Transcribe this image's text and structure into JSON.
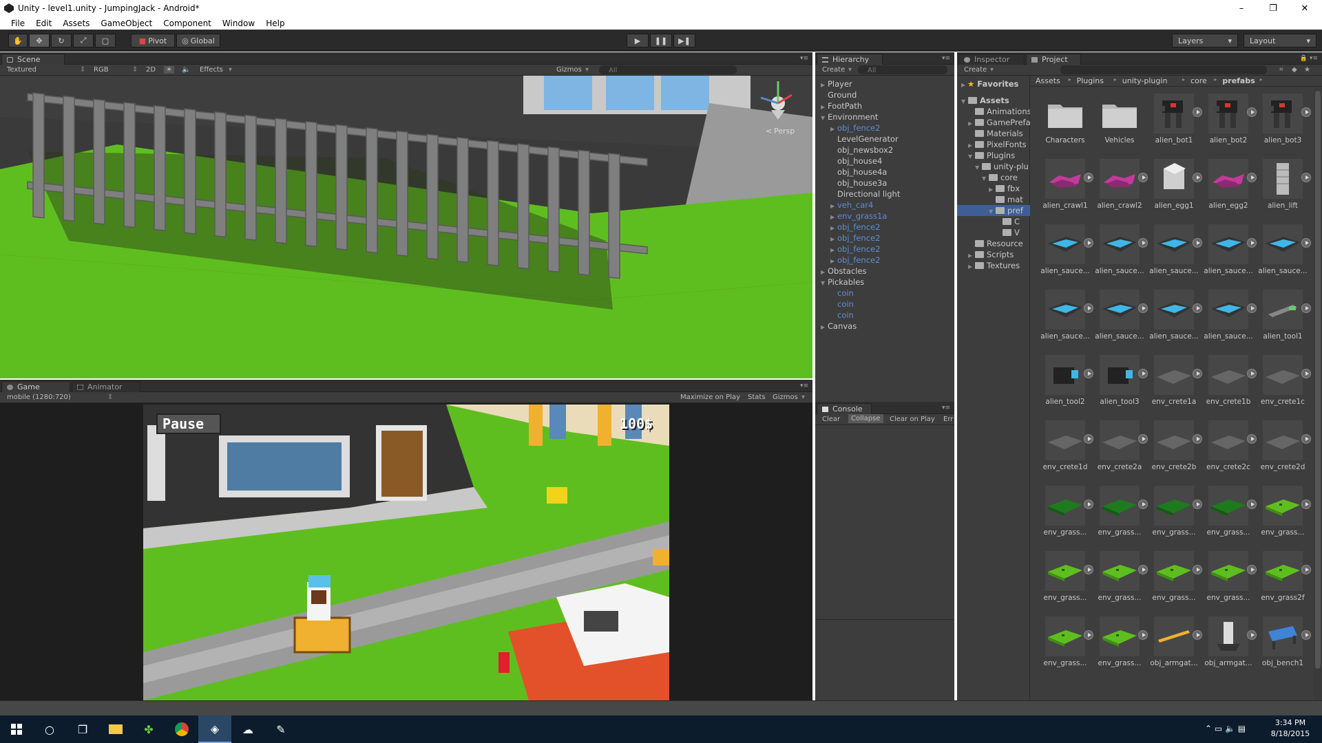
{
  "window": {
    "title": "Unity - level1.unity - JumpingJack - Android*",
    "minimize": "–",
    "maximize": "❐",
    "close": "✕"
  },
  "menu": [
    "File",
    "Edit",
    "Assets",
    "GameObject",
    "Component",
    "Window",
    "Help"
  ],
  "toolbar": {
    "pivot": "Pivot",
    "global": "Global",
    "layers": "Layers",
    "layout": "Layout"
  },
  "scene": {
    "tab": "Scene",
    "shading": "Textured",
    "render": "RGB",
    "mode2d": "2D",
    "effects": "Effects",
    "gizmos": "Gizmos",
    "search_placeholder": "All",
    "persp": "Persp"
  },
  "game": {
    "tab_game": "Game",
    "tab_animator": "Animator",
    "resolution": "mobile (1280:720)",
    "maximize": "Maximize on Play",
    "stats": "Stats",
    "gizmos": "Gizmos",
    "pause": "Pause",
    "score": "100$"
  },
  "hierarchy": {
    "tab": "Hierarchy",
    "create": "Create",
    "search_placeholder": "All",
    "items": [
      {
        "label": "Player",
        "arrow": "▶",
        "indent": 0,
        "blue": false
      },
      {
        "label": "Ground",
        "arrow": "",
        "indent": 0,
        "blue": false
      },
      {
        "label": "FootPath",
        "arrow": "▶",
        "indent": 0,
        "blue": false
      },
      {
        "label": "Environment",
        "arrow": "▼",
        "indent": 0,
        "blue": false
      },
      {
        "label": "obj_fence2",
        "arrow": "▶",
        "indent": 1,
        "blue": true
      },
      {
        "label": "LevelGenerator",
        "arrow": "",
        "indent": 1,
        "blue": false
      },
      {
        "label": "obj_newsbox2",
        "arrow": "",
        "indent": 1,
        "blue": false
      },
      {
        "label": "obj_house4",
        "arrow": "",
        "indent": 1,
        "blue": false
      },
      {
        "label": "obj_house4a",
        "arrow": "",
        "indent": 1,
        "blue": false
      },
      {
        "label": "obj_house3a",
        "arrow": "",
        "indent": 1,
        "blue": false
      },
      {
        "label": "Directional light",
        "arrow": "",
        "indent": 1,
        "blue": false
      },
      {
        "label": "veh_car4",
        "arrow": "▶",
        "indent": 1,
        "blue": true
      },
      {
        "label": "env_grass1a",
        "arrow": "▶",
        "indent": 1,
        "blue": true
      },
      {
        "label": "obj_fence2",
        "arrow": "▶",
        "indent": 1,
        "blue": true
      },
      {
        "label": "obj_fence2",
        "arrow": "▶",
        "indent": 1,
        "blue": true
      },
      {
        "label": "obj_fence2",
        "arrow": "▶",
        "indent": 1,
        "blue": true
      },
      {
        "label": "obj_fence2",
        "arrow": "▶",
        "indent": 1,
        "blue": true
      },
      {
        "label": "Obstacles",
        "arrow": "▶",
        "indent": 0,
        "blue": false
      },
      {
        "label": "Pickables",
        "arrow": "▼",
        "indent": 0,
        "blue": false
      },
      {
        "label": "coin",
        "arrow": "",
        "indent": 1,
        "blue": true
      },
      {
        "label": "coin",
        "arrow": "",
        "indent": 1,
        "blue": true
      },
      {
        "label": "coin",
        "arrow": "",
        "indent": 1,
        "blue": true
      },
      {
        "label": "Canvas",
        "arrow": "▶",
        "indent": 0,
        "blue": false
      }
    ]
  },
  "console": {
    "tab": "Console",
    "clear": "Clear",
    "collapse": "Collapse",
    "clear_on_play": "Clear on Play",
    "error": "Err"
  },
  "project": {
    "tab_inspector": "Inspector",
    "tab_project": "Project",
    "create": "Create",
    "favorites": "Favorites",
    "breadcrumb": [
      "Assets",
      "Plugins",
      "unity-plugin",
      "core",
      "prefabs"
    ],
    "tree": [
      {
        "label": "Assets",
        "indent": 0,
        "arrow": "▼",
        "bold": true
      },
      {
        "label": "Animations",
        "indent": 1,
        "arrow": ""
      },
      {
        "label": "GamePrefa",
        "indent": 1,
        "arrow": "▶"
      },
      {
        "label": "Materials",
        "indent": 1,
        "arrow": ""
      },
      {
        "label": "PixelFonts",
        "indent": 1,
        "arrow": "▶"
      },
      {
        "label": "Plugins",
        "indent": 1,
        "arrow": "▼"
      },
      {
        "label": "unity-plu",
        "indent": 2,
        "arrow": "▼"
      },
      {
        "label": "core",
        "indent": 3,
        "arrow": "▼"
      },
      {
        "label": "fbx",
        "indent": 4,
        "arrow": "▶"
      },
      {
        "label": "mat",
        "indent": 4,
        "arrow": ""
      },
      {
        "label": "pref",
        "indent": 4,
        "arrow": "▼",
        "selected": true
      },
      {
        "label": "C",
        "indent": 5,
        "arrow": ""
      },
      {
        "label": "V",
        "indent": 5,
        "arrow": ""
      },
      {
        "label": "Resource",
        "indent": 1,
        "arrow": ""
      },
      {
        "label": "Scripts",
        "indent": 1,
        "arrow": "▶"
      },
      {
        "label": "Textures",
        "indent": 1,
        "arrow": "▶"
      }
    ],
    "assets": [
      {
        "label": "Characters",
        "kind": "folder"
      },
      {
        "label": "Vehicles",
        "kind": "folder"
      },
      {
        "label": "alien_bot1",
        "kind": "bot"
      },
      {
        "label": "alien_bot2",
        "kind": "bot"
      },
      {
        "label": "alien_bot3",
        "kind": "bot"
      },
      {
        "label": "alien_crawl1",
        "kind": "crawl"
      },
      {
        "label": "alien_crawl2",
        "kind": "crawl"
      },
      {
        "label": "alien_egg1",
        "kind": "egg"
      },
      {
        "label": "alien_egg2",
        "kind": "crawl"
      },
      {
        "label": "alien_lift",
        "kind": "lift"
      },
      {
        "label": "alien_sauce...",
        "kind": "saucer"
      },
      {
        "label": "alien_sauce...",
        "kind": "saucer"
      },
      {
        "label": "alien_sauce...",
        "kind": "saucer"
      },
      {
        "label": "alien_sauce...",
        "kind": "saucer"
      },
      {
        "label": "alien_sauce...",
        "kind": "saucer"
      },
      {
        "label": "alien_sauce...",
        "kind": "saucer"
      },
      {
        "label": "alien_sauce...",
        "kind": "saucer"
      },
      {
        "label": "alien_sauce...",
        "kind": "saucer"
      },
      {
        "label": "alien_sauce...",
        "kind": "saucer"
      },
      {
        "label": "alien_tool1",
        "kind": "tool"
      },
      {
        "label": "alien_tool2",
        "kind": "tool2"
      },
      {
        "label": "alien_tool3",
        "kind": "tool2"
      },
      {
        "label": "env_crete1a",
        "kind": "crete"
      },
      {
        "label": "env_crete1b",
        "kind": "crete"
      },
      {
        "label": "env_crete1c",
        "kind": "crete"
      },
      {
        "label": "env_crete1d",
        "kind": "crete"
      },
      {
        "label": "env_crete2a",
        "kind": "crete"
      },
      {
        "label": "env_crete2b",
        "kind": "crete"
      },
      {
        "label": "env_crete2c",
        "kind": "crete"
      },
      {
        "label": "env_crete2d",
        "kind": "crete"
      },
      {
        "label": "env_grass...",
        "kind": "grassd"
      },
      {
        "label": "env_grass...",
        "kind": "grassd"
      },
      {
        "label": "env_grass...",
        "kind": "grassd"
      },
      {
        "label": "env_grass...",
        "kind": "grassd"
      },
      {
        "label": "env_grass...",
        "kind": "grass"
      },
      {
        "label": "env_grass...",
        "kind": "grass"
      },
      {
        "label": "env_grass...",
        "kind": "grass"
      },
      {
        "label": "env_grass...",
        "kind": "grass"
      },
      {
        "label": "env_grass...",
        "kind": "grass"
      },
      {
        "label": "env_grass2f",
        "kind": "grass"
      },
      {
        "label": "env_grass...",
        "kind": "grass"
      },
      {
        "label": "env_grass...",
        "kind": "grass"
      },
      {
        "label": "obj_armgat...",
        "kind": "arm"
      },
      {
        "label": "obj_armgat...",
        "kind": "armpost"
      },
      {
        "label": "obj_bench1",
        "kind": "bench"
      }
    ]
  },
  "taskbar": {
    "time": "3:34 PM",
    "date": "8/18/2015"
  },
  "colors": {
    "editor_bg": "#474747",
    "panel_dark": "#3d3d3d",
    "prefab_blue": "#5b8fd6",
    "selection": "#3e5f96",
    "grass": "#5fbe1f",
    "taskbar": "#0c1c2c"
  }
}
